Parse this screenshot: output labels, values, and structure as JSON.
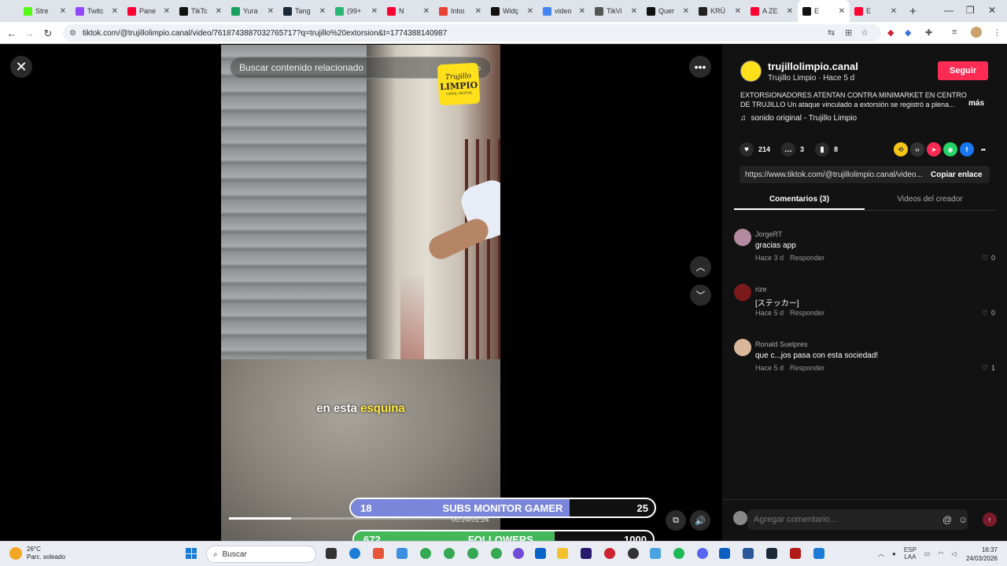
{
  "browser": {
    "tabs": [
      {
        "title": "Stre",
        "color": "#53fc18"
      },
      {
        "title": "Twitc",
        "color": "#9146ff"
      },
      {
        "title": "Pane",
        "color": "#ff0033"
      },
      {
        "title": "TikTc",
        "color": "#111111"
      },
      {
        "title": "Yura",
        "color": "#1aa15f"
      },
      {
        "title": "Tang",
        "color": "#1b2838"
      },
      {
        "title": "(99+",
        "color": "#2bb673"
      },
      {
        "title": "N",
        "color": "#ff0033"
      },
      {
        "title": "Inbo",
        "color": "#ea4335"
      },
      {
        "title": "Widç",
        "color": "#111111"
      },
      {
        "title": "video",
        "color": "#4285f4"
      },
      {
        "title": "TikVi",
        "color": "#555555"
      },
      {
        "title": "Quer",
        "color": "#111111"
      },
      {
        "title": "KRÜ",
        "color": "#222222"
      },
      {
        "title": "A ZE",
        "color": "#ff0033"
      },
      {
        "title": "E",
        "color": "#111111"
      },
      {
        "title": "E",
        "color": "#ff0033"
      }
    ],
    "new_tab": "+",
    "minimize": "—",
    "maximize": "❐",
    "close": "✕",
    "url": "tiktok.com/@trujillolimpio.canal/video/7618743887032765717?q=trujillo%20extorsion&t=1774388140987"
  },
  "viewer": {
    "close_glyph": "✕",
    "search_placeholder": "Buscar contenido relacionado",
    "search_glyph": "⌕",
    "more_glyph": "•••",
    "up_glyph": "︿",
    "down_glyph": "﹀",
    "caption_plain": "en esta ",
    "caption_highlight": "esquina",
    "logo": {
      "line1": "Trujillo",
      "line2": "LIMPIO",
      "line3": "CANAL DIGITAL"
    },
    "progress_fraction": 0.24,
    "timecode": "00:24/01:24",
    "pip_glyph": "⧉",
    "volume_glyph": "🔊",
    "overlay_subs": {
      "left": "18",
      "label": "SUBS MONITOR GAMER",
      "right": "25",
      "fraction": 0.72,
      "color": "#7a86d9"
    },
    "overlay_followers": {
      "left": "672",
      "label": "FOLLOWERS",
      "right": "1000",
      "fraction": 0.67,
      "color": "#45b85c"
    }
  },
  "panel": {
    "username": "trujillolimpio.canal",
    "subline": "Trujillo Limpio · Hace 5 d",
    "follow_label": "Seguir",
    "description": "EXTORSIONADORES ATENTAN CONTRA MINIMARKET EN CENTRO DE TRUJILLO Un ataque vinculado a extorsión se registró a plena...",
    "more_label": "más",
    "sound": "sonido original - Trujillo Limpio",
    "sound_glyph": "♫",
    "likes": "214",
    "comments_count": "3",
    "saves": "8",
    "like_glyph": "♥",
    "comment_glyph": "…",
    "save_glyph": "▮",
    "link_url": "https://www.tiktok.com/@trujillolimpio.canal/video...",
    "copy_label": "Copiar enlace",
    "tab_comments": "Comentarios (3)",
    "tab_videos": "Videos del creador",
    "reply_label": "Responder",
    "comments": [
      {
        "user": "JorgeRT",
        "text": "gracias app",
        "time": "Hace 3 d",
        "likes": "0",
        "avatar_color": "#b48aa0"
      },
      {
        "user": "rize",
        "text": "[ステッカー]",
        "time": "Hace 5 d",
        "likes": "0",
        "avatar_color": "#7a1b1b"
      },
      {
        "user": "Ronald Suelpres",
        "text": "que c...jos pasa con esta sociedad!",
        "time": "Hace 5 d",
        "likes": "1",
        "avatar_color": "#d9b79a"
      }
    ],
    "comment_placeholder": "Agregar comentario...",
    "at_glyph": "@",
    "emoji_glyph": "☺",
    "send_glyph": "↑"
  },
  "taskbar": {
    "temperature": "26°C",
    "weather": "Parc. soleado",
    "search_label": "Buscar",
    "language": "ESP",
    "layout": "LAA",
    "time": "16:37",
    "date": "24/03/2026"
  }
}
